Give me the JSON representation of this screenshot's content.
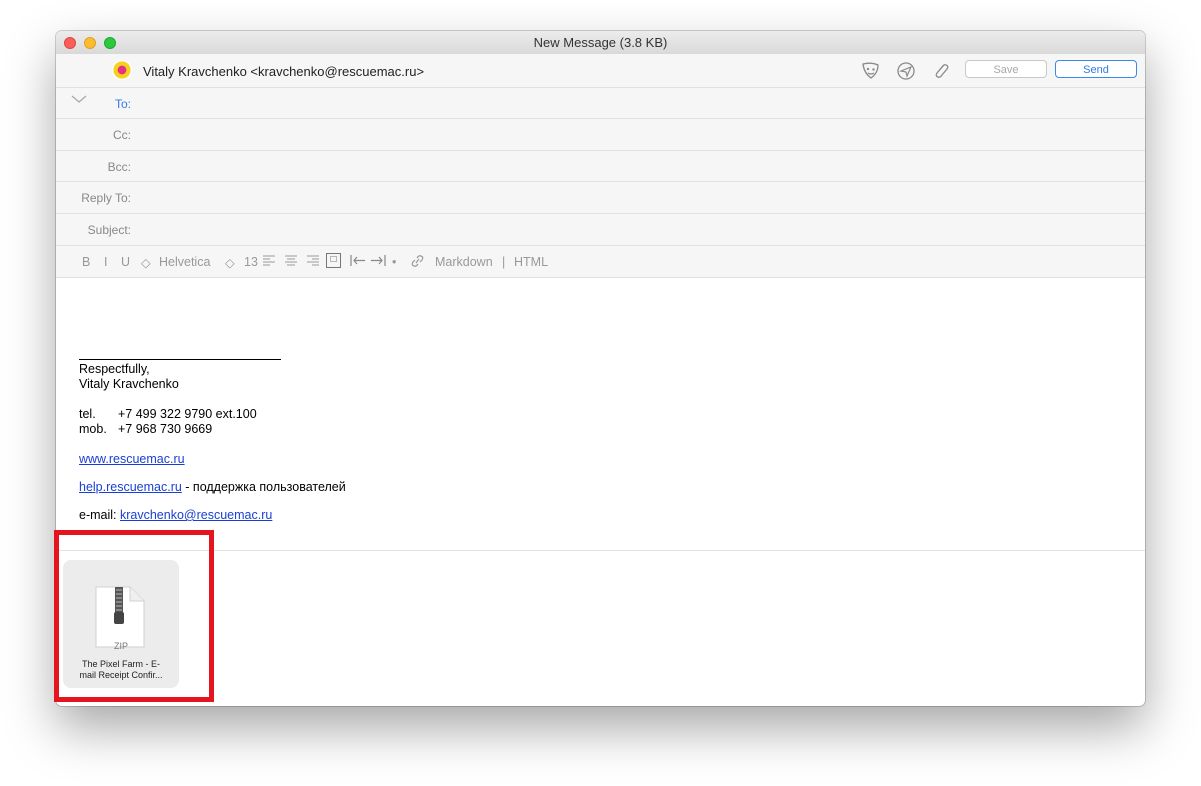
{
  "window": {
    "title": "New Message (3.8 KB)"
  },
  "header": {
    "from": "Vitaly Kravchenko <kravchenko@rescuemac.ru>",
    "save_label": "Save",
    "send_label": "Send",
    "fields": {
      "to": "To:",
      "cc": "Cc:",
      "bcc": "Bcc:",
      "reply_to": "Reply To:",
      "subject": "Subject:"
    }
  },
  "toolbar": {
    "bold": "B",
    "italic": "I",
    "underline": "U",
    "font": "Helvetica",
    "size": "13",
    "markdown": "Markdown",
    "separator": "|",
    "html": "HTML"
  },
  "signature": {
    "greeting": "Respectfully,",
    "name": "Vitaly Kravchenko",
    "tel_label": "tel.",
    "tel_value": "+7 499 322 9790 ext.100",
    "mob_label": "mob.",
    "mob_value": "+7 968 730 9669",
    "website": "www.rescuemac.ru",
    "help_link": "help.rescuemac.ru",
    "help_text": " - поддержка пользователей",
    "email_label": "e-mail: ",
    "email_value": "kravchenko@rescuemac.ru"
  },
  "attachment": {
    "type_label": "ZIP",
    "name_line1": "The Pixel Farm - E-",
    "name_line2": "mail Receipt Confir..."
  },
  "colors": {
    "accent": "#2f7de1",
    "highlight": "#e4151f",
    "link": "#1a3fd4"
  },
  "icons": [
    "mask-icon",
    "send-later-icon",
    "paperclip-icon",
    "chevron-down-icon",
    "zip-file-icon"
  ]
}
